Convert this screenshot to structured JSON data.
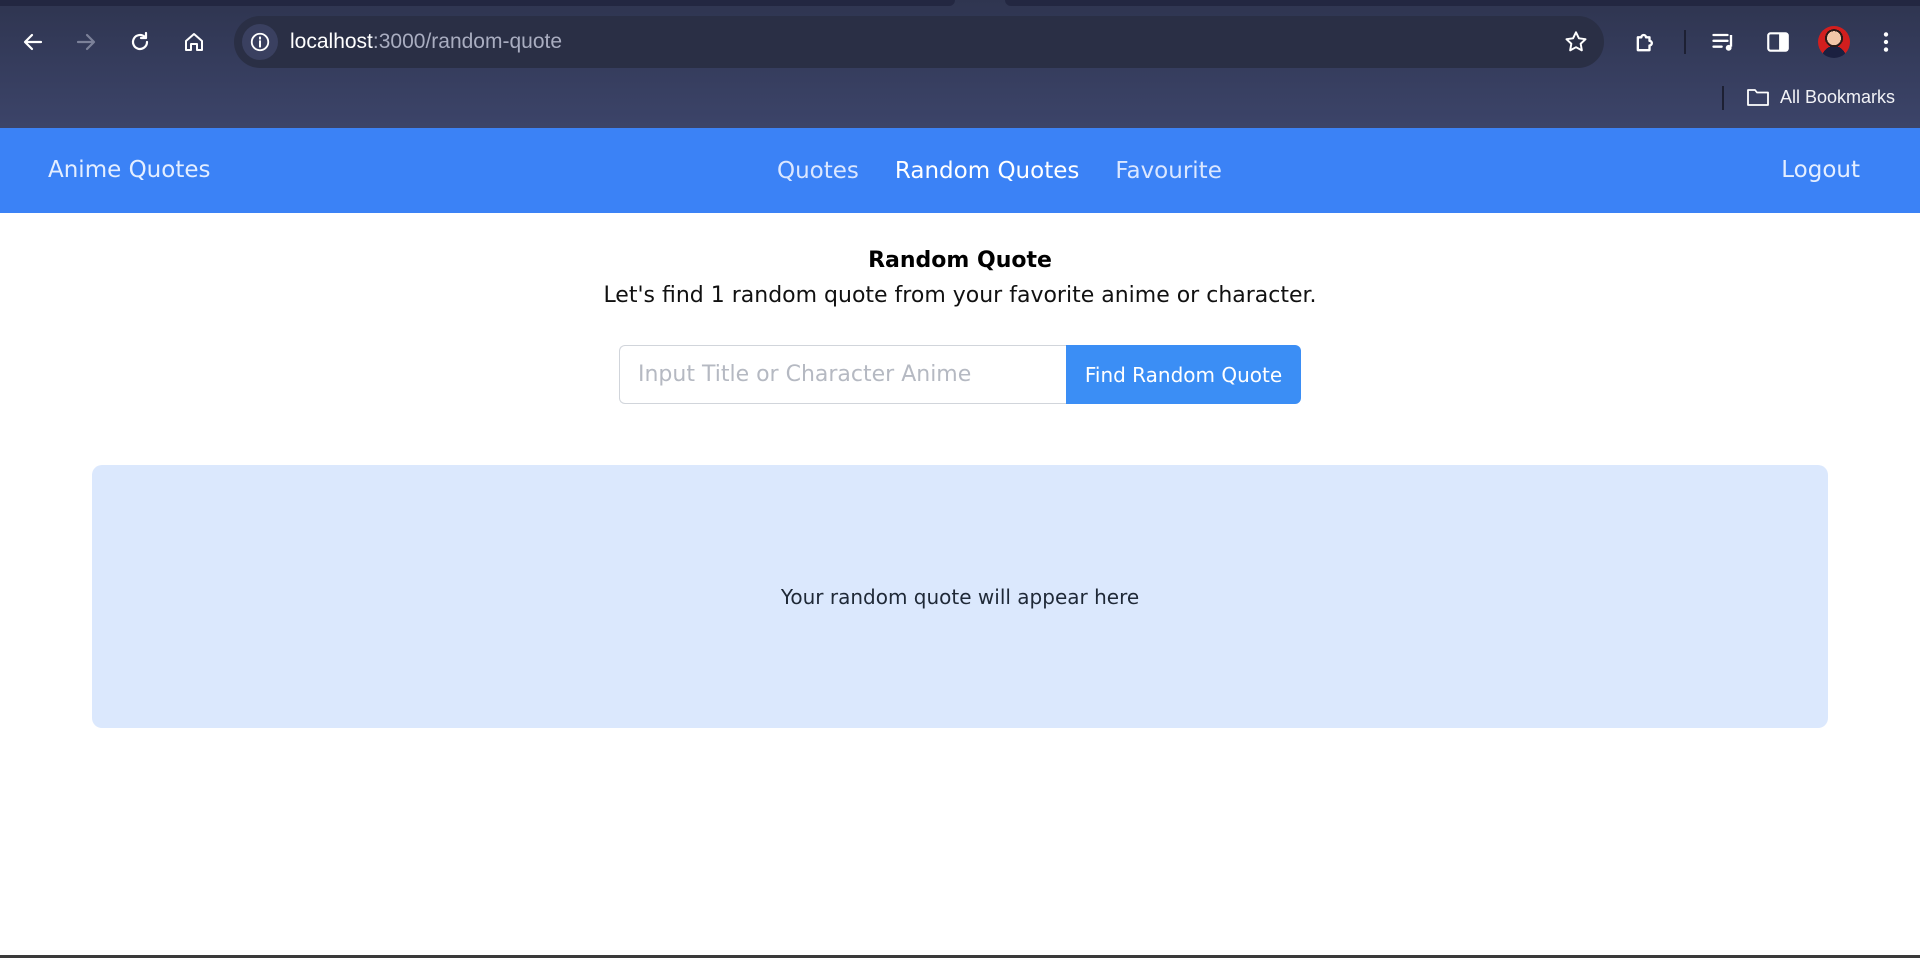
{
  "browser": {
    "url_host": "localhost",
    "url_path": ":3000/random-quote",
    "bookmarks_label": "All Bookmarks",
    "icons": [
      "back-icon",
      "forward-icon",
      "reload-icon",
      "home-icon",
      "site-info-icon",
      "bookmark-star-icon",
      "extensions-icon",
      "media-controls-icon",
      "side-panel-icon",
      "profile-avatar",
      "more-menu-icon",
      "folder-icon"
    ]
  },
  "navbar": {
    "brand": "Anime Quotes",
    "links": [
      {
        "label": "Quotes",
        "active": false
      },
      {
        "label": "Random Quotes",
        "active": true
      },
      {
        "label": "Favourite",
        "active": false
      }
    ],
    "logout": "Logout"
  },
  "main": {
    "title": "Random Quote",
    "subtitle": "Let's find 1 random quote from your favorite anime or character.",
    "search": {
      "placeholder": "Input Title or Character Anime",
      "value": ""
    },
    "find_button": "Find Random Quote",
    "quote_placeholder": "Your random quote will appear here"
  },
  "colors": {
    "navbar_bg": "#3b82f6",
    "button_bg": "#3b8ef5",
    "quote_box_bg": "#dbe8fd",
    "chrome_bg": "#353c5c"
  }
}
